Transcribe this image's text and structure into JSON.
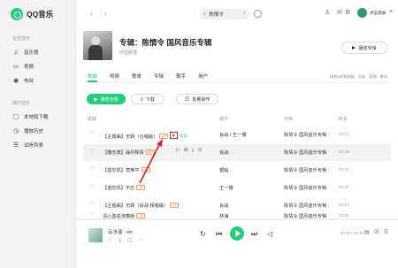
{
  "app": {
    "logo_text": "QQ音乐"
  },
  "sidebar": {
    "sections": [
      {
        "title": "在线音乐",
        "items": [
          {
            "label": "音乐馆",
            "icon": "music-note-icon"
          },
          {
            "label": "视频",
            "icon": "video-icon"
          },
          {
            "label": "电台",
            "icon": "radio-icon"
          }
        ]
      },
      {
        "title": "我的音乐",
        "items": [
          {
            "label": "本地和下载",
            "icon": "computer-icon"
          },
          {
            "label": "播放历史",
            "icon": "clock-icon"
          },
          {
            "label": "试听列表",
            "icon": "list-icon"
          }
        ]
      }
    ]
  },
  "topbar": {
    "back_icon": "chevron-left-icon",
    "forward_icon": "chevron-right-icon",
    "search_value": "陈情令",
    "login_text": "点击登录"
  },
  "album": {
    "title": "专辑：陈情令 国风音乐专辑",
    "subtitle": "中国数据",
    "play_label": "播放专辑"
  },
  "tabs": [
    "歌曲",
    "视频",
    "歌单",
    "专辑",
    "歌手",
    "用户"
  ],
  "tab_meta": [
    "找到153首歌曲",
    "全部",
    "高潮",
    "歌词"
  ],
  "actions": {
    "play_all": "播放全部",
    "download": "下载",
    "batch": "批量操作"
  },
  "table": {
    "headers": {
      "title": "歌曲",
      "artist": "歌手",
      "album": "专辑",
      "duration": "时长"
    },
    "rows": [
      {
        "title": "【主题曲】无羁（合唱版）",
        "badge": "VIP",
        "mv": true,
        "tag": "标清",
        "artist": "肖战 / 王一博",
        "album": "陈情令 国风音乐专辑",
        "duration": "04:13"
      },
      {
        "title": "【魏无羡】曲尽陈情",
        "badge": "VIP",
        "artist": "肖战",
        "album": "陈情令 国风音乐专辑",
        "duration": "03:33"
      },
      {
        "title": "【蓝忘机】意难平",
        "badge": "VIP",
        "artist": "银临",
        "album": "陈情令 国风音乐专辑",
        "duration": "04:23"
      },
      {
        "title": "【蓝忘机】不忘",
        "badge": "VIP",
        "artist": "王一博",
        "album": "陈情令 国风音乐专辑",
        "duration": "03:47"
      },
      {
        "title": "【主题曲】无羁（肖战 独唱版）",
        "badge": "VIP",
        "artist": "肖战",
        "album": "陈情令 国风音乐专辑",
        "duration": "04:13"
      },
      {
        "title": "清心音名演奏版",
        "badge": "VIP",
        "artist": "林海",
        "album": "陈情令 国风音乐专辑",
        "duration": "02:35"
      }
    ]
  },
  "player": {
    "track": "云水谣 - en",
    "time": "00:00 / 04:01",
    "colors": {
      "accent": "#1ecf7c"
    }
  },
  "annotation": {
    "color": "#e02020"
  }
}
